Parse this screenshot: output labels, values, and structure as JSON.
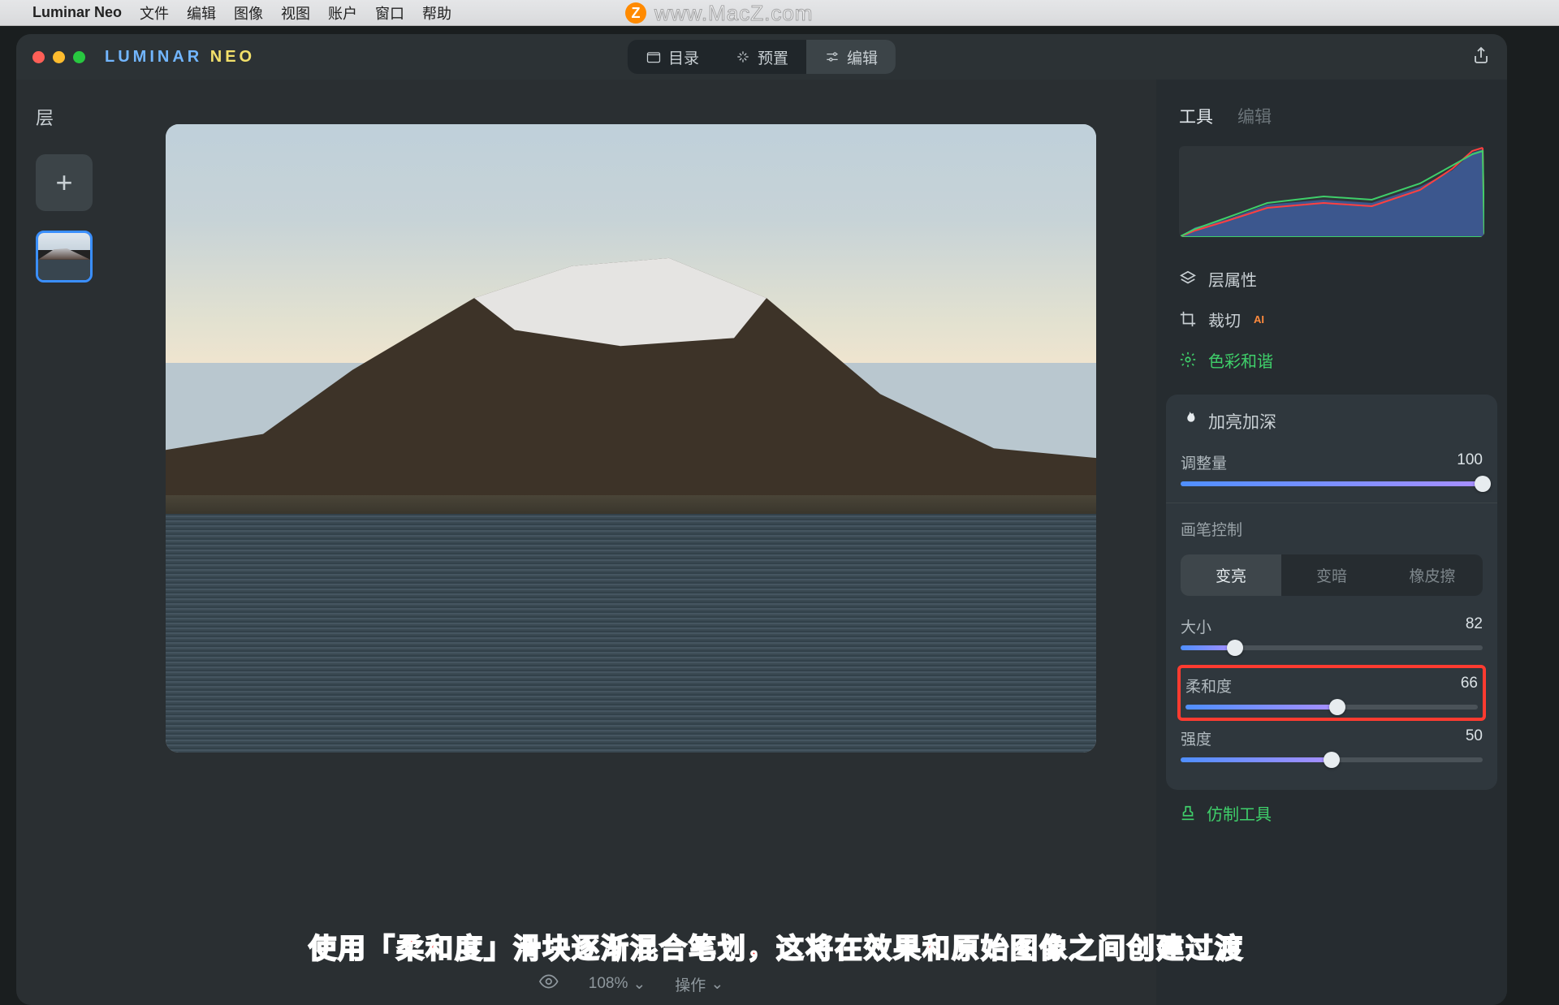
{
  "menubar": {
    "items": [
      "Luminar Neo",
      "文件",
      "编辑",
      "图像",
      "视图",
      "账户",
      "窗口",
      "帮助"
    ]
  },
  "watermark": {
    "badge": "Z",
    "url": "www.MacZ.com"
  },
  "logo": {
    "part1": "LUMINAR",
    "part2": " NEO"
  },
  "topTabs": [
    {
      "label": "目录",
      "icon": "folder-icon"
    },
    {
      "label": "预置",
      "icon": "sparkle-icon"
    },
    {
      "label": "编辑",
      "icon": "sliders-icon",
      "active": true
    }
  ],
  "left": {
    "heading": "层"
  },
  "bottom": {
    "zoom": "108%",
    "ops": "操作"
  },
  "rightTabs": {
    "tools": "工具",
    "edit": "编辑"
  },
  "tools": {
    "layerProps": "层属性",
    "crop": "裁切",
    "cropAI": "AI",
    "colorHarmony": "色彩和谐"
  },
  "panel": {
    "title": "加亮加深",
    "adjustment": {
      "label": "调整量",
      "value": 100,
      "pct": 100
    },
    "brushControl": "画笔控制",
    "seg": {
      "lighten": "变亮",
      "darken": "变暗",
      "erase": "橡皮擦"
    },
    "size": {
      "label": "大小",
      "value": 82,
      "pct": 18
    },
    "soft": {
      "label": "柔和度",
      "value": 66,
      "pct": 52
    },
    "strength": {
      "label": "强度",
      "value": 50,
      "pct": 50
    }
  },
  "clone": "仿制工具",
  "caption": "使用「柔和度」滑块逐渐混合笔划，这将在效果和原始图像之间创建过渡"
}
